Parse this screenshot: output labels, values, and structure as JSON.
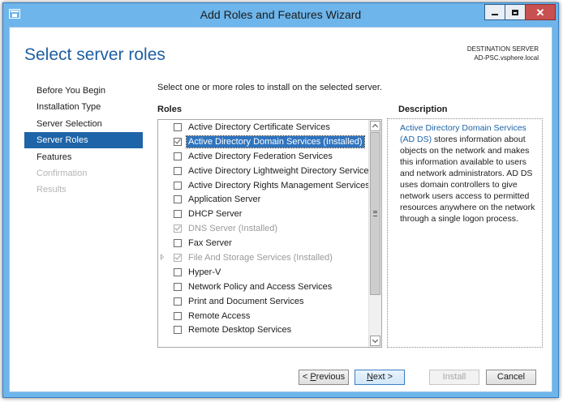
{
  "window": {
    "title": "Add Roles and Features Wizard"
  },
  "header": {
    "page_title": "Select server roles",
    "destination_label": "DESTINATION SERVER",
    "destination_server": "AD-PSC.vsphere.local"
  },
  "nav": {
    "items": [
      {
        "label": "Before You Begin",
        "state": "normal"
      },
      {
        "label": "Installation Type",
        "state": "normal"
      },
      {
        "label": "Server Selection",
        "state": "normal"
      },
      {
        "label": "Server Roles",
        "state": "active"
      },
      {
        "label": "Features",
        "state": "normal"
      },
      {
        "label": "Confirmation",
        "state": "disabled"
      },
      {
        "label": "Results",
        "state": "disabled"
      }
    ]
  },
  "main": {
    "instruction": "Select one or more roles to install on the selected server.",
    "roles_label": "Roles",
    "description_label": "Description",
    "roles": [
      {
        "label": "Active Directory Certificate Services",
        "checked": false,
        "installed": false
      },
      {
        "label": "Active Directory Domain Services (Installed)",
        "checked": true,
        "installed": false,
        "selected": true
      },
      {
        "label": "Active Directory Federation Services",
        "checked": false,
        "installed": false
      },
      {
        "label": "Active Directory Lightweight Directory Services",
        "checked": false,
        "installed": false
      },
      {
        "label": "Active Directory Rights Management Services",
        "checked": false,
        "installed": false
      },
      {
        "label": "Application Server",
        "checked": false,
        "installed": false
      },
      {
        "label": "DHCP Server",
        "checked": false,
        "installed": false
      },
      {
        "label": "DNS Server (Installed)",
        "checked": true,
        "installed": true
      },
      {
        "label": "Fax Server",
        "checked": false,
        "installed": false
      },
      {
        "label": "File And Storage Services (Installed)",
        "checked": true,
        "installed": true,
        "expandable": true
      },
      {
        "label": "Hyper-V",
        "checked": false,
        "installed": false
      },
      {
        "label": "Network Policy and Access Services",
        "checked": false,
        "installed": false
      },
      {
        "label": "Print and Document Services",
        "checked": false,
        "installed": false
      },
      {
        "label": "Remote Access",
        "checked": false,
        "installed": false
      },
      {
        "label": "Remote Desktop Services",
        "checked": false,
        "installed": false
      }
    ],
    "description": {
      "link_text": "Active Directory Domain Services (AD DS)",
      "body": " stores information about objects on the network and makes this information available to users and network administrators. AD DS uses domain controllers to give network users access to permitted resources anywhere on the network through a single logon process."
    }
  },
  "buttons": {
    "previous": {
      "prefix": "< ",
      "mnemonic": "P",
      "rest": "revious"
    },
    "next": {
      "mnemonic": "N",
      "rest": "ext >"
    },
    "install": "Install",
    "cancel": "Cancel"
  },
  "colors": {
    "title_blue": "#1e5fa3",
    "selection_blue": "#1e64a8",
    "frame_blue": "#6db5ea"
  }
}
